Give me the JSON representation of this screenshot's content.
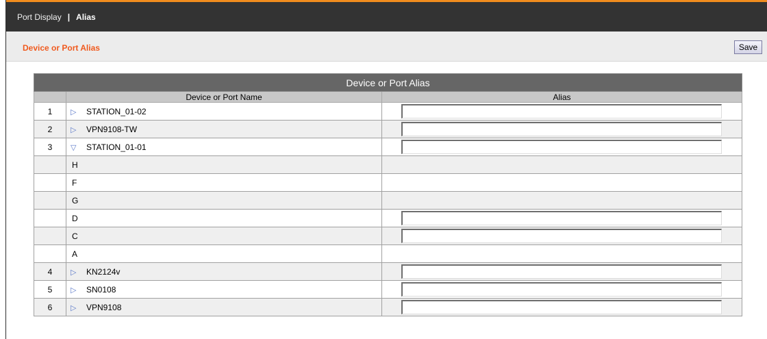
{
  "header": {
    "breadcrumb_parent": "Port Display",
    "breadcrumb_separator": "|",
    "breadcrumb_current": "Alias"
  },
  "subheader": {
    "title": "Device or Port Alias",
    "save_label": "Save"
  },
  "table": {
    "caption": "Device or Port Alias",
    "col_name": "Device or Port Name",
    "col_alias": "Alias",
    "rows": [
      {
        "num": "1",
        "name": "STATION_01-02",
        "arrow": "▷",
        "has_input": true,
        "alias": ""
      },
      {
        "num": "2",
        "name": "VPN9108-TW",
        "arrow": "▷",
        "has_input": true,
        "alias": ""
      },
      {
        "num": "3",
        "name": "STATION_01-01",
        "arrow": "▽",
        "has_input": true,
        "alias": ""
      },
      {
        "num": "",
        "name": "H",
        "arrow": "",
        "has_input": false,
        "alias": ""
      },
      {
        "num": "",
        "name": "F",
        "arrow": "",
        "has_input": false,
        "alias": ""
      },
      {
        "num": "",
        "name": "G",
        "arrow": "",
        "has_input": false,
        "alias": ""
      },
      {
        "num": "",
        "name": "D",
        "arrow": "",
        "has_input": true,
        "alias": ""
      },
      {
        "num": "",
        "name": "C",
        "arrow": "",
        "has_input": true,
        "alias": ""
      },
      {
        "num": "",
        "name": "A",
        "arrow": "",
        "has_input": false,
        "alias": ""
      },
      {
        "num": "4",
        "name": "KN2124v",
        "arrow": "▷",
        "has_input": true,
        "alias": ""
      },
      {
        "num": "5",
        "name": "SN0108",
        "arrow": "▷",
        "has_input": true,
        "alias": ""
      },
      {
        "num": "6",
        "name": "VPN9108",
        "arrow": "▷",
        "has_input": true,
        "alias": ""
      }
    ]
  },
  "colors": {
    "accent": "#f08c1e",
    "subtitle": "#f05a1e",
    "topbar_bg": "#333333",
    "caption_bg": "#666666",
    "arrow": "#5a78c8"
  },
  "icons": {
    "collapsed": "triangle-right-icon",
    "expanded": "triangle-down-icon"
  }
}
